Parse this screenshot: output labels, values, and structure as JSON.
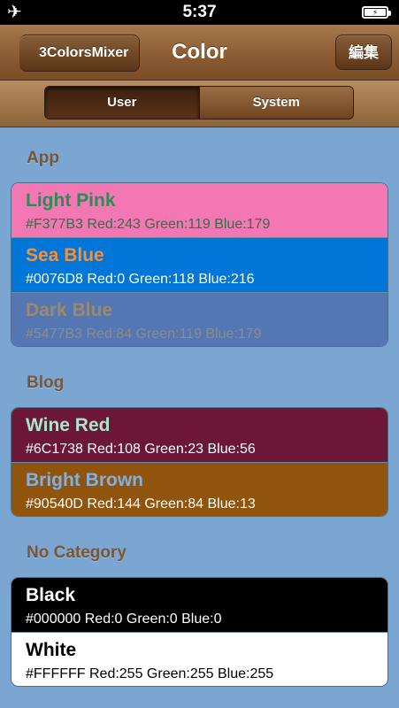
{
  "status_bar": {
    "time": "5:37",
    "airplane_icon": "airplane-icon",
    "battery_icon": "battery-charging-icon"
  },
  "nav": {
    "back_label": "3ColorsMixer",
    "title": "Color",
    "edit_label": "編集"
  },
  "segments": {
    "user_label": "User",
    "system_label": "System",
    "selected": "User"
  },
  "sections": [
    {
      "header": "App",
      "colors": [
        {
          "name": "Light Pink",
          "info": "#F377B3 Red:243 Green:119 Blue:179",
          "bg": "#F377B3",
          "name_color": "#2e8b57",
          "info_color": "#2f6f4a"
        },
        {
          "name": "Sea Blue",
          "info": "#0076D8 Red:0 Green:118 Blue:216",
          "bg": "#0076D8",
          "name_color": "#f2913b",
          "info_color": "#ffffff"
        },
        {
          "name": "Dark Blue",
          "info": "#5477B3 Red:84 Green:119 Blue:179",
          "bg": "#5477B3",
          "name_color": "#9c8a6c",
          "info_color": "#8e8c86"
        }
      ]
    },
    {
      "header": "Blog",
      "colors": [
        {
          "name": "Wine Red",
          "info": "#6C1738 Red:108 Green:23 Blue:56",
          "bg": "#6C1738",
          "name_color": "#a8e6cf",
          "info_color": "#ffffff"
        },
        {
          "name": "Bright Brown",
          "info": "#90540D Red:144 Green:84 Blue:13",
          "bg": "#90540D",
          "name_color": "#7fb1e6",
          "info_color": "#ffffff"
        }
      ]
    },
    {
      "header": "No Category",
      "colors": [
        {
          "name": "Black",
          "info": "#000000 Red:0 Green:0 Blue:0",
          "bg": "#000000",
          "name_color": "#ffffff",
          "info_color": "#ffffff"
        },
        {
          "name": "White",
          "info": "#FFFFFF Red:255 Green:255 Blue:255",
          "bg": "#FFFFFF",
          "name_color": "#000000",
          "info_color": "#000000"
        }
      ]
    }
  ],
  "colors": {
    "background": "#7aa6d1",
    "section_header": "#7a5638",
    "nav_brown": "#8a5a32"
  }
}
